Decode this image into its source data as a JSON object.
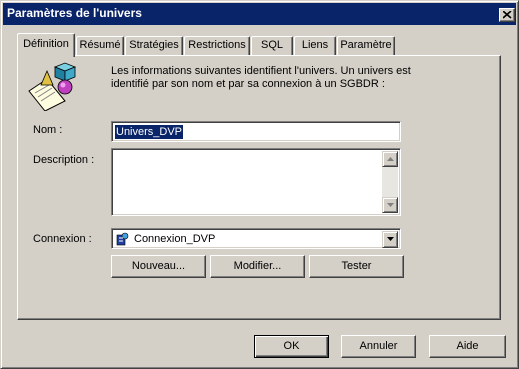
{
  "window": {
    "title": "Paramètres de l'univers"
  },
  "tabs": [
    {
      "label": "Définition",
      "active": true
    },
    {
      "label": "Résumé"
    },
    {
      "label": "Stratégies"
    },
    {
      "label": "Restrictions"
    },
    {
      "label": "SQL"
    },
    {
      "label": "Liens"
    },
    {
      "label": "Paramètre"
    }
  ],
  "definition": {
    "intro": "Les informations suivantes identifient l'univers. Un univers est identifié par son nom et par sa connexion à un SGBDR :",
    "icon": "universe-icon",
    "name_label": "Nom :",
    "name_value": "Univers_DVP",
    "description_label": "Description :",
    "description_value": "",
    "connection_label": "Connexion :",
    "connection_value": "Connexion_DVP",
    "connection_icon": "database-connection-icon",
    "buttons": {
      "new": "Nouveau...",
      "modify": "Modifier...",
      "test": "Tester"
    }
  },
  "footer": {
    "ok": "OK",
    "cancel": "Annuler",
    "help": "Aide"
  }
}
